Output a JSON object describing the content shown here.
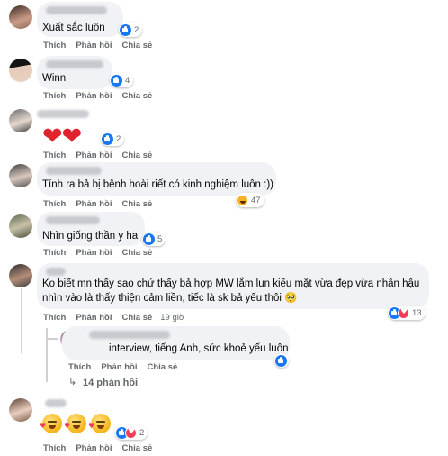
{
  "labels": {
    "like": "Thích",
    "reply": "Phản hồi",
    "share": "Chia sẻ"
  },
  "comments": [
    {
      "text": "Xuất sắc luôn",
      "reactions": "2"
    },
    {
      "text": "Winn",
      "reactions": "4"
    },
    {
      "text": "❤❤",
      "reactions": "2"
    },
    {
      "text": "Tính ra bả bị bệnh hoài riết có kinh nghiệm luôn :))",
      "reactions": "47"
    },
    {
      "text": "Nhìn giống thần y ha",
      "reactions": "5"
    },
    {
      "text_line1": "Ko biết mn thấy sao chứ thấy bả hợp MW lắm lun kiểu mặt vừa đẹp vừa nhân hậu",
      "text_line2": "nhìn vào là thấy thiện cảm liền, tiếc là sk bả yếu thôi 🥺",
      "time": "19 giờ",
      "reactions": "13"
    },
    {
      "text": "interview, tiếng Anh, sức khoẻ yếu luôn"
    },
    {
      "reactions": "2"
    }
  ],
  "more_replies": "14 phản hồi",
  "colors": {
    "like": "#1877f2",
    "love": "#f33e58",
    "haha": "#f7b125",
    "bubble": "#f0f2f5",
    "meta": "#65676b"
  }
}
